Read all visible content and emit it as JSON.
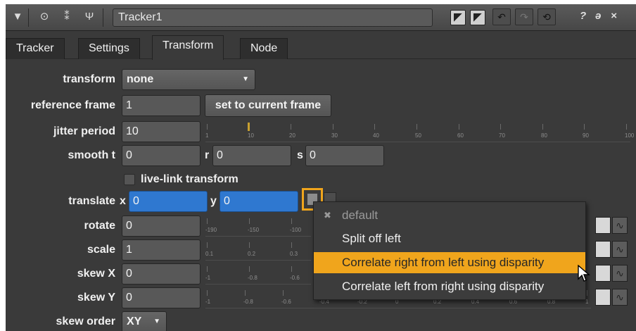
{
  "titlebar": {
    "node_name": "Tracker1",
    "icons": [
      "triangle-down-icon",
      "viewer-icon",
      "tracks-icon",
      "tool-icon"
    ],
    "right_icons": [
      "copy-icon",
      "paste-icon",
      "undo-icon",
      "redo-icon",
      "revert-icon",
      "help-icon",
      "float-icon",
      "close-icon"
    ],
    "help_glyph": "?",
    "float_glyph": "ə",
    "close_glyph": "×"
  },
  "tabs": [
    {
      "label": "Tracker"
    },
    {
      "label": "Settings"
    },
    {
      "label": "Transform"
    },
    {
      "label": "Node"
    }
  ],
  "form": {
    "transform_label": "transform",
    "transform_value": "none",
    "reference_frame_label": "reference frame",
    "reference_frame_value": "1",
    "set_current_label": "set to current frame",
    "jitter_label": "jitter period",
    "jitter_value": "10",
    "jitter_slider_fraction": 0.1,
    "jitter_ticks": [
      "1",
      "10",
      "20",
      "30",
      "40",
      "50",
      "60",
      "70",
      "80",
      "90",
      "100"
    ],
    "smooth_label": "smooth t",
    "smooth_t": "0",
    "r_label": "r",
    "smooth_r": "0",
    "s_label": "s",
    "smooth_s": "0",
    "livelink_label": "live-link transform",
    "translate_label": "translate",
    "x_label": "x",
    "translate_x": "0",
    "y_label": "y",
    "translate_y": "0",
    "rotate_label": "rotate",
    "rotate_value": "0",
    "rotate_ticks": [
      "-190",
      "-150",
      "-100"
    ],
    "scale_label": "scale",
    "scale_value": "1",
    "scale_ticks": [
      "0.1",
      "0.2",
      "0.3"
    ],
    "skewx_label": "skew X",
    "skewx_value": "0",
    "skewx_ticks": [
      "-1",
      "-0.8",
      "-0.6"
    ],
    "skewy_label": "skew Y",
    "skewy_value": "0",
    "skewy_ticks": [
      "-1",
      "-0.8",
      "-0.6",
      "-0.4",
      "-0.2",
      "0",
      "0.2",
      "0.4",
      "0.6",
      "0.8",
      "1"
    ],
    "skew_order_label": "skew order",
    "skew_order_value": "XY"
  },
  "menu": {
    "items": [
      {
        "label": "default"
      },
      {
        "label": "Split off left"
      },
      {
        "label": "Correlate right from left using disparity"
      },
      {
        "label": "Correlate left from right using disparity"
      }
    ]
  },
  "colors": {
    "highlight": "#f0a51c",
    "field_blue": "#2f78d0",
    "panel": "#3a3a3a"
  }
}
